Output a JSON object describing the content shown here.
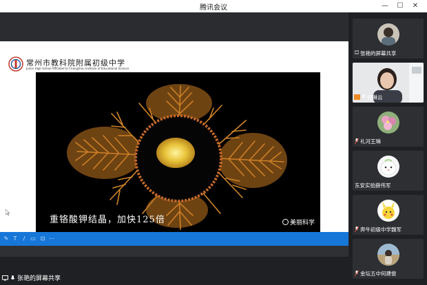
{
  "window": {
    "title": "腾讯会议",
    "min": "—",
    "max": "☐",
    "close": "✕"
  },
  "share": {
    "school_name": "常州市教科院附属初级中学",
    "school_sub": "Junior High School Affiliated to Changzhou Institute of Educational Science",
    "caption": "重铬酸钾结晶，加快125倍",
    "watermark": "美丽科学"
  },
  "toolbar_icons": [
    "brush-icon",
    "text-icon",
    "pen-icon",
    "eraser-icon",
    "screenshot-icon",
    "more-icon"
  ],
  "sharer_label": "张艳的屏幕共享",
  "participants": [
    {
      "name": "张艳的屏幕共享",
      "type": "avatar",
      "icon": "screen-icon"
    },
    {
      "name": "钱琳云",
      "type": "camera",
      "icon": "user-icon"
    },
    {
      "name": "礼河王琳",
      "type": "avatar",
      "icon": "mic-icon"
    },
    {
      "name": "东安实验薛伟军",
      "type": "avatar",
      "icon": ""
    },
    {
      "name": "奔牛初级中学魏军",
      "type": "avatar",
      "icon": "mic-icon"
    },
    {
      "name": "金坛五中何建俊",
      "type": "avatar",
      "icon": "mic-icon"
    }
  ],
  "colors": {
    "accent": "#1677d8",
    "panel_bg": "#1f2023",
    "tile_bg": "#2d2f33",
    "crystal": "#d4872a"
  }
}
